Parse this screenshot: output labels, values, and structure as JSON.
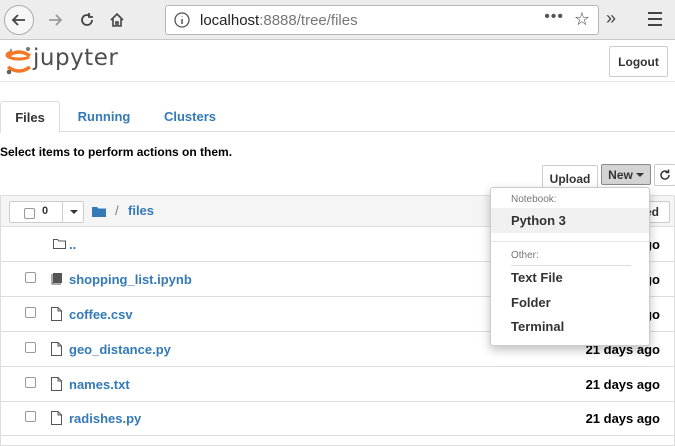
{
  "browser": {
    "url_host": "localhost",
    "url_path": ":8888/tree/files",
    "url_dots": "•••"
  },
  "header": {
    "logo_text": "jupyter",
    "logout_label": "Logout"
  },
  "tabs": [
    {
      "label": "Files"
    },
    {
      "label": "Running"
    },
    {
      "label": "Clusters"
    }
  ],
  "instructions": "Select items to perform actions on them.",
  "toolbar": {
    "upload_label": "Upload",
    "new_label": "New",
    "refresh_icon": "refresh-icon"
  },
  "list_header": {
    "selected_count": "0",
    "breadcrumb_separator": "/",
    "breadcrumb_folder": "files",
    "sort_label_visible": "ed"
  },
  "files": [
    {
      "name": "..",
      "date": "",
      "icon": "folder-icon",
      "date_visible": "ago"
    },
    {
      "name": "shopping_list.ipynb",
      "date": "",
      "icon": "notebook-icon",
      "date_visible": "ago"
    },
    {
      "name": "coffee.csv",
      "date": "",
      "icon": "file-icon",
      "date_visible": "ago"
    },
    {
      "name": "geo_distance.py",
      "date": "",
      "icon": "file-icon",
      "date_visible": "21 days ago"
    },
    {
      "name": "names.txt",
      "date": "21 days ago",
      "icon": "file-icon"
    },
    {
      "name": "radishes.py",
      "date": "21 days ago",
      "icon": "file-icon"
    }
  ],
  "new_menu": {
    "notebook_header": "Notebook:",
    "notebook_items": [
      "Python 3"
    ],
    "other_header": "Other:",
    "other_items": [
      "Text File",
      "Folder",
      "Terminal"
    ]
  },
  "colors": {
    "link": "#337ab7",
    "logo_orange": "#f37726"
  }
}
